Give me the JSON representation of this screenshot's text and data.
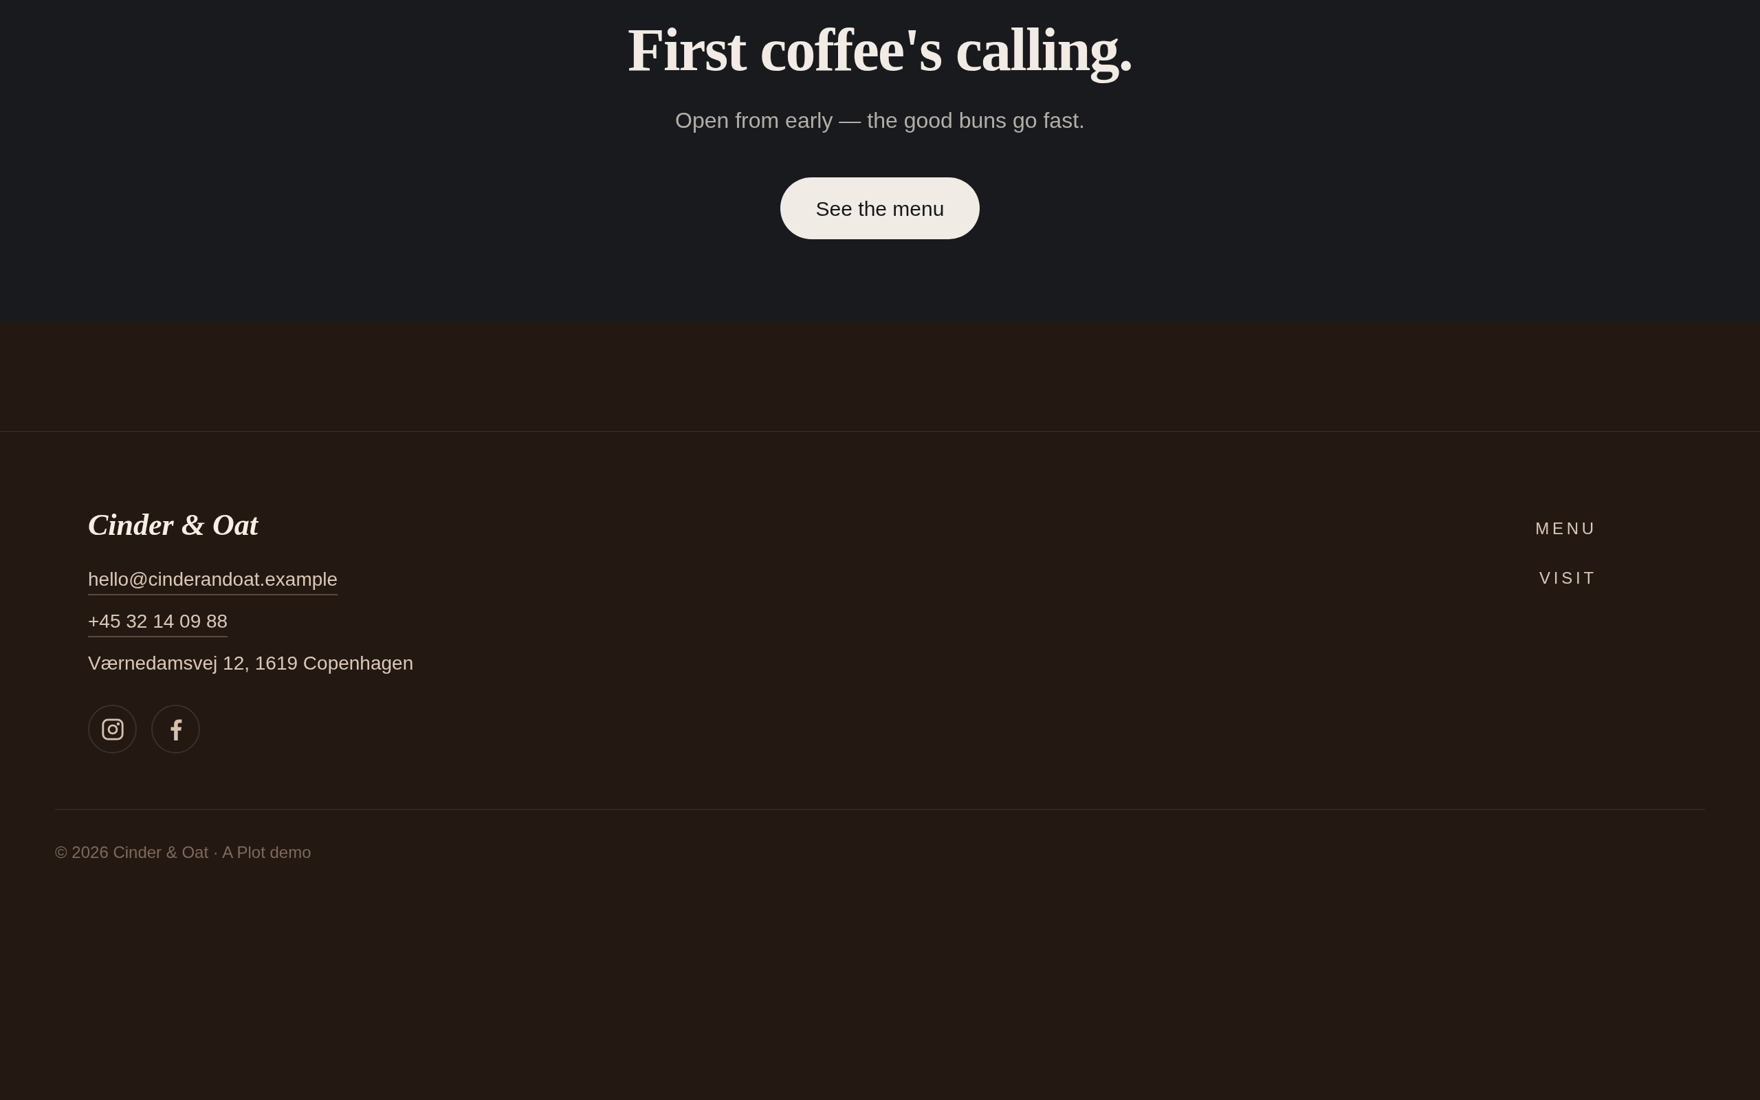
{
  "hero": {
    "title": "First coffee's calling.",
    "subtitle": "Open from early — the good buns go fast.",
    "button": "See the menu"
  },
  "footer": {
    "brand": "Cinder & Oat",
    "contacts": [
      {
        "kind": "link",
        "text": "hello@cinderandoat.example"
      },
      {
        "kind": "link",
        "text": "+45 32 14 09 88"
      },
      {
        "kind": "text",
        "text": "Værnedamsvej 12, 1619 Copenhagen"
      }
    ],
    "social": [
      {
        "kind": "instagram"
      },
      {
        "kind": "facebook"
      }
    ],
    "nav": [
      "MENU",
      "VISIT"
    ],
    "copyright": "© 2026 Cinder & Oat · A Plot demo"
  }
}
